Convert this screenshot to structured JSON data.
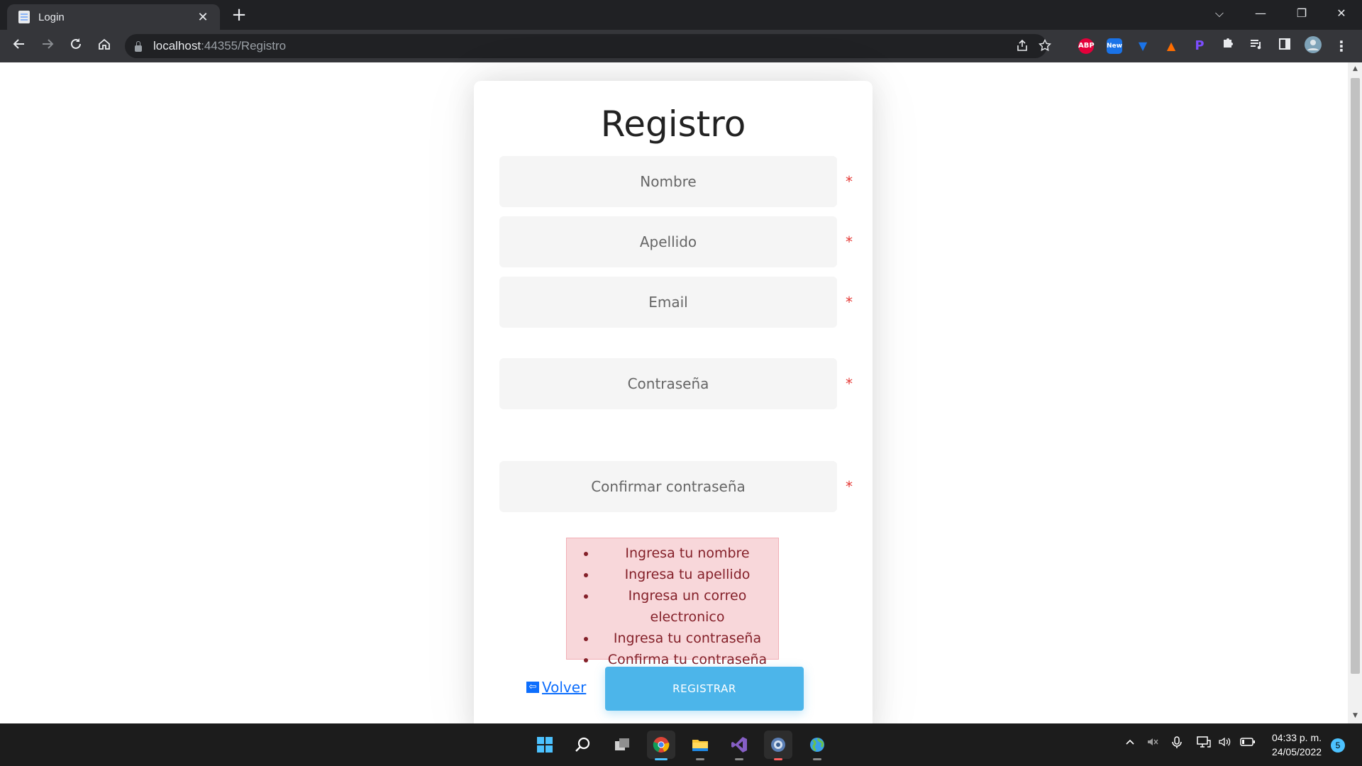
{
  "browser": {
    "tab_title": "Login",
    "tab_close": "✕",
    "new_tab": "+",
    "url_host": "localhost",
    "url_rest": ":44355/Registro",
    "window_controls": {
      "collapse": "⌵",
      "minimize": "—",
      "restore": "❐",
      "close": "✕"
    },
    "extensions": [
      {
        "name": "abp",
        "label": "ABP",
        "color": "#e4003a"
      },
      {
        "name": "new",
        "label": "New",
        "color": "#1a73e8"
      },
      {
        "name": "shield",
        "label": "▼",
        "color": "#1a73e8"
      },
      {
        "name": "rocket",
        "label": "▲",
        "color": "#ff6d00"
      },
      {
        "name": "p",
        "label": "P",
        "color": "#673ab7"
      }
    ]
  },
  "form": {
    "title": "Registro",
    "required_mark": "*",
    "fields": {
      "nombre": "Nombre",
      "apellido": "Apellido",
      "email": "Email",
      "password": "Contraseña",
      "confirm": "Confirmar contraseña"
    },
    "errors": [
      "Ingresa tu nombre",
      "Ingresa tu apellido",
      "Ingresa un correo electronico",
      "Ingresa tu contraseña",
      "Confirma tu contraseña"
    ],
    "back_label": "Volver",
    "back_icon": "⇦",
    "submit_label": "REGISTRAR"
  },
  "taskbar": {
    "time": "04:33 p. m.",
    "date": "24/05/2022",
    "notifications": "5"
  }
}
